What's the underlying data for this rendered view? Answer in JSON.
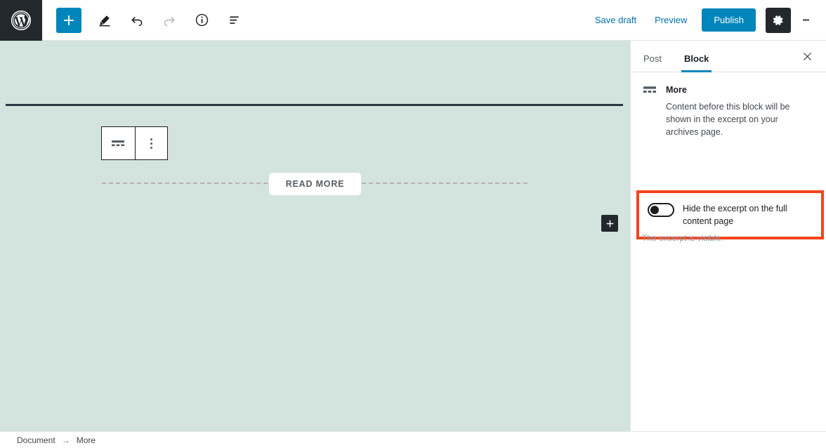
{
  "app": {
    "name": "WordPress Block Editor",
    "logo_icon": "wordpress-logo-icon"
  },
  "toolbar": {
    "add_block_label": "+",
    "add_block_icon": "plus-icon",
    "edit_icon": "pencil-icon",
    "undo_icon": "undo-arrow-icon",
    "redo_icon": "redo-arrow-icon",
    "info_icon": "info-circle-icon",
    "outline_icon": "content-structure-icon",
    "save_draft_label": "Save draft",
    "preview_label": "Preview",
    "publish_label": "Publish",
    "settings_icon": "gear-icon",
    "more_menu_icon": "kebab-vertical-icon"
  },
  "canvas": {
    "block_toolbar": {
      "block_type_icon": "more-block-icon",
      "options_icon": "kebab-vertical-icon"
    },
    "more_block": {
      "read_more_label": "READ MORE"
    },
    "inserter_icon": "plus-icon",
    "background_color": "#d3e3dd"
  },
  "sidebar": {
    "tabs": [
      {
        "label": "Post",
        "active": false
      },
      {
        "label": "Block",
        "active": true
      }
    ],
    "close_icon": "close-x-icon",
    "block_card": {
      "icon": "more-block-icon",
      "title": "More",
      "description": "Content before this block will be shown in the excerpt on your archives page."
    },
    "toggle": {
      "label": "Hide the excerpt on the full content page",
      "state": "off",
      "help_text": "The excerpt is visible.",
      "highlight_color": "#f4441e"
    }
  },
  "statusbar": {
    "breadcrumb": [
      {
        "label": "Document"
      },
      {
        "label": "More"
      }
    ],
    "separator": "→"
  },
  "colors": {
    "accent_blue": "#0085ba",
    "link_blue": "#0073aa",
    "dark": "#23282d",
    "highlight_red": "#f4441e"
  }
}
